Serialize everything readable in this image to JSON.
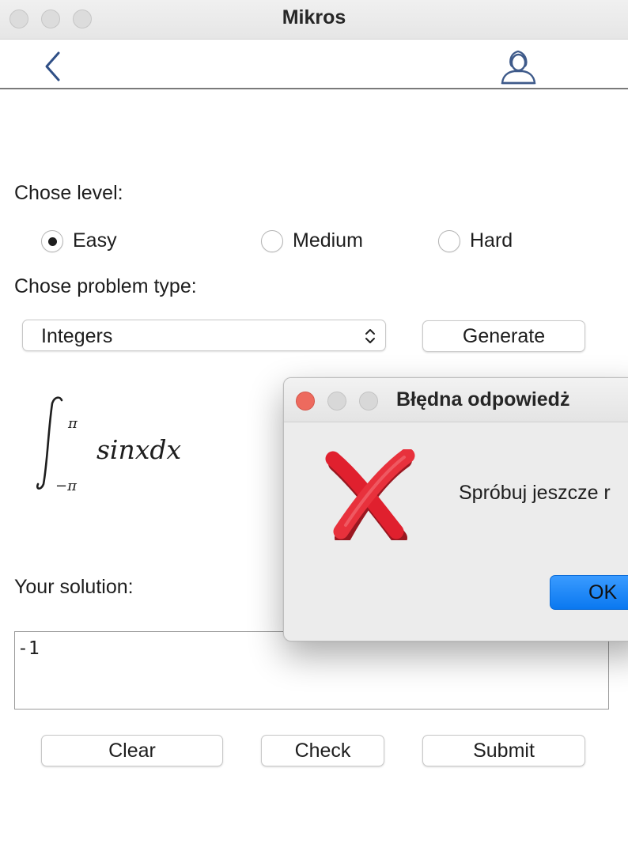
{
  "window": {
    "title": "Mikros"
  },
  "level": {
    "label": "Chose level:",
    "options": [
      "Easy",
      "Medium",
      "Hard"
    ],
    "selected": "Easy"
  },
  "problem_type": {
    "label": "Chose problem type:",
    "selected": "Integers",
    "generate_label": "Generate"
  },
  "problem": {
    "integrand": "sinxdx",
    "upper_limit": "π",
    "lower_limit": "−π"
  },
  "solution": {
    "label": "Your solution:",
    "value": "-1"
  },
  "actions": {
    "clear_label": "Clear",
    "check_label": "Check",
    "submit_label": "Submit"
  },
  "dialog": {
    "title": "Błędna odpowiedż",
    "message": "Spróbuj jeszcze r",
    "ok_label": "OK",
    "close_color": "#ed6a5e"
  }
}
